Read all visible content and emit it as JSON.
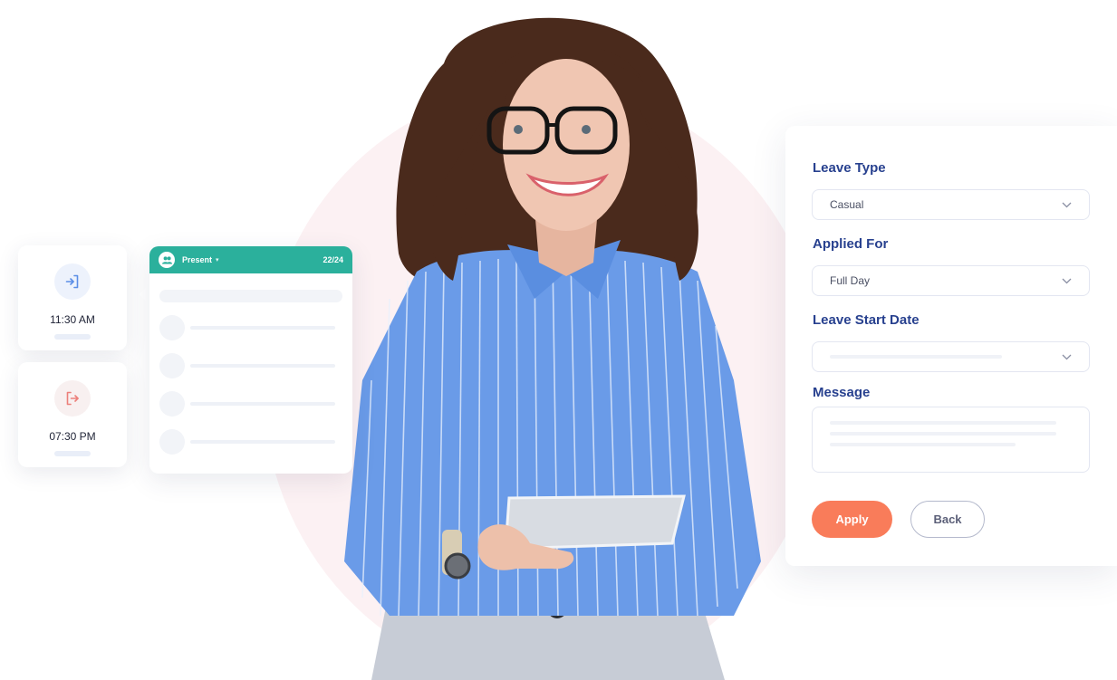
{
  "time_cards": {
    "check_in": {
      "icon": "login-arrow-icon",
      "time": "11:30 AM",
      "color": "#5b8ee6"
    },
    "check_out": {
      "icon": "logout-arrow-icon",
      "time": "07:30 PM",
      "color": "#ec7f7a"
    }
  },
  "attendance": {
    "status": "Present",
    "count": "22/24",
    "header_color": "#2bb09c",
    "icon": "people-icon"
  },
  "leave_form": {
    "leave_type": {
      "label": "Leave Type",
      "value": "Casual"
    },
    "applied_for": {
      "label": "Applied For",
      "value": "Full Day"
    },
    "leave_start_date": {
      "label": "Leave Start Date",
      "value": ""
    },
    "message": {
      "label": "Message",
      "value": ""
    },
    "apply_label": "Apply",
    "back_label": "Back",
    "label_color": "#28418f",
    "apply_color": "#f97c5a"
  }
}
